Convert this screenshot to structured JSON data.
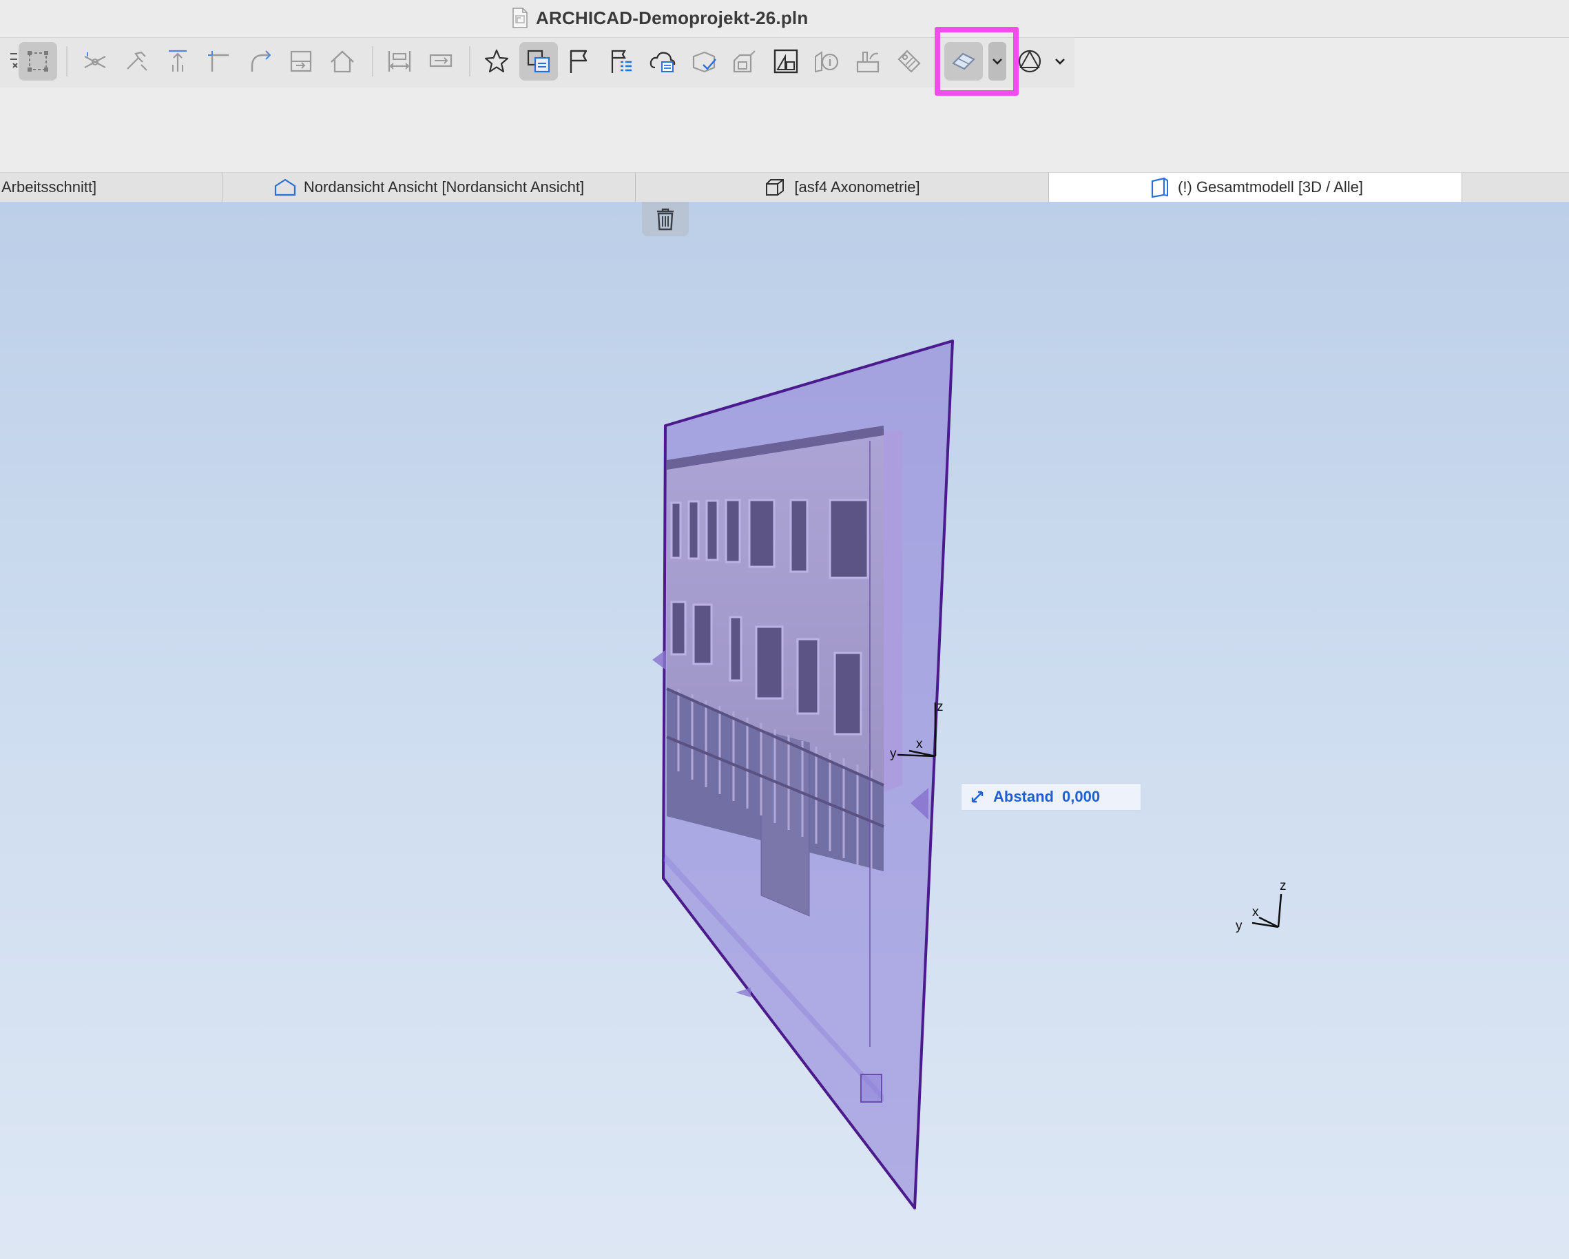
{
  "window": {
    "title": "ARCHICAD-Demoprojekt-26.pln",
    "document_icon": "pln-document-icon"
  },
  "toolbar": {
    "highlight_color": "#ee4ee9",
    "buttons": [
      {
        "name": "dimension-tool-icon",
        "active": false
      },
      {
        "name": "marquee-tool-icon",
        "active": true
      },
      {
        "name": "trim-tool-icon",
        "active": false
      },
      {
        "name": "adjust-tool-icon",
        "active": false
      },
      {
        "name": "elevate-tool-icon",
        "active": false
      },
      {
        "name": "intersect-tool-icon",
        "active": false
      },
      {
        "name": "fillet-tool-icon",
        "active": false
      },
      {
        "name": "split-tool-icon",
        "active": false
      },
      {
        "name": "roof-tool-icon",
        "active": false
      },
      {
        "name": "distribute-tool-icon",
        "active": false
      },
      {
        "name": "stretch-tool-icon",
        "active": false
      },
      {
        "name": "favorites-star-icon",
        "active": false
      },
      {
        "name": "layout-book-icon",
        "active": true
      },
      {
        "name": "flag-icon",
        "active": false
      },
      {
        "name": "schedule-list-icon",
        "active": false
      },
      {
        "name": "cloud-sync-icon",
        "active": false
      },
      {
        "name": "surface-check-icon",
        "active": false
      },
      {
        "name": "model-compare-icon",
        "active": false
      },
      {
        "name": "section-view-icon",
        "active": false
      },
      {
        "name": "info-shapes-icon",
        "active": false
      },
      {
        "name": "renovation-icon",
        "active": false
      },
      {
        "name": "tag-icon",
        "active": false
      },
      {
        "name": "cutting-plane-icon",
        "active": true
      },
      {
        "name": "shape-display-icon",
        "active": false
      }
    ]
  },
  "tabs": [
    {
      "label": "Arbeitsschnitt]",
      "icon": "section-icon",
      "active": false
    },
    {
      "label": "Nordansicht Ansicht [Nordansicht Ansicht]",
      "icon": "elevation-icon",
      "active": false
    },
    {
      "label": "[asf4 Axonometrie]",
      "icon": "axonometry-icon",
      "active": false
    },
    {
      "label": "(!) Gesamtmodell [3D / Alle]",
      "icon": "3d-model-icon",
      "active": true
    }
  ],
  "viewport": {
    "trash_icon": "trash-icon",
    "distance_tooltip": {
      "label": "Abstand",
      "value": "0,000",
      "icon": "resize-arrow-icon"
    },
    "local_axes": {
      "x": "x",
      "y": "y",
      "z": "z"
    },
    "global_axes": {
      "x": "x",
      "y": "y",
      "z": "z"
    },
    "cutting_plane_color": "#8877d6",
    "cutting_plane_edge_color": "#4b1a8c"
  }
}
